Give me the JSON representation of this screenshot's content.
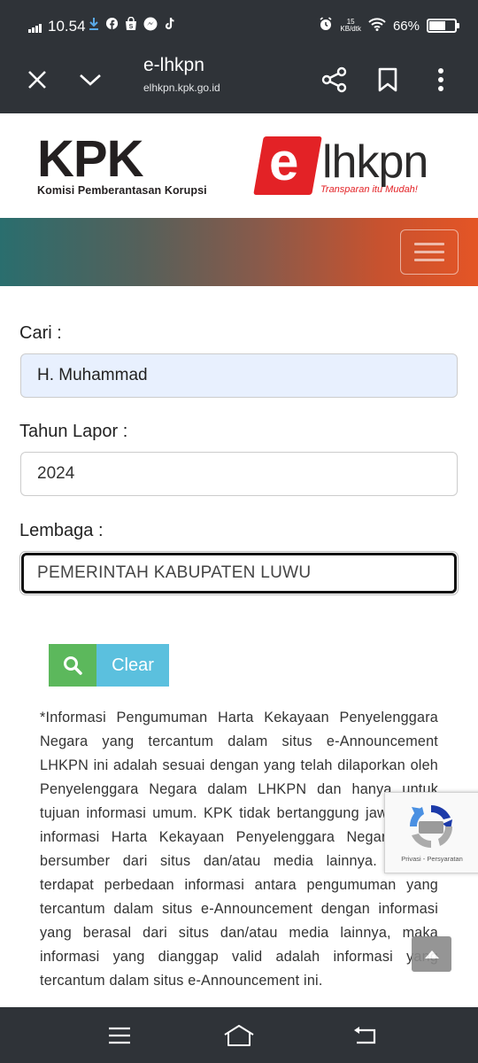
{
  "status_bar": {
    "time": "10.54",
    "kb_value": "15",
    "kb_unit": "KB/dtk",
    "battery": "66%",
    "battery_level": 0.66,
    "icons": [
      "signal-icon",
      "download-icon",
      "facebook-icon",
      "shop-icon",
      "messenger-icon",
      "tiktok-icon",
      "alarm-icon",
      "wifi-icon",
      "battery-icon"
    ]
  },
  "browser": {
    "title": "e-lhkpn",
    "url": "elhkpn.kpk.go.id"
  },
  "header": {
    "kpk_logo_text": "KPK",
    "kpk_subtitle": "Komisi Pemberantasan Korupsi",
    "elhkpn_e": "e",
    "elhkpn_rest": "lhkpn",
    "elhkpn_tagline": "Transparan itu Mudah!"
  },
  "form": {
    "cari_label": "Cari :",
    "cari_value": "H. Muhammad",
    "tahun_label": "Tahun Lapor :",
    "tahun_value": "2024",
    "lembaga_label": "Lembaga :",
    "lembaga_value": "PEMERINTAH KABUPATEN LUWU",
    "clear_label": "Clear"
  },
  "disclaimer": "*Informasi Pengumuman Harta Kekayaan Penyelenggara Negara yang tercantum dalam situs e-Announcement LHKPN ini adalah sesuai dengan yang telah dilaporkan oleh Penyelenggara Negara dalam LHKPN dan hanya untuk tujuan informasi umum. KPK tidak bertanggung jawab atas informasi Harta Kekayaan Penyelenggara Negara yang bersumber dari situs dan/atau media lainnya. Apabila terdapat perbedaan informasi antara pengumuman yang tercantum dalam situs e-Announcement dengan informasi yang berasal dari situs dan/atau media lainnya, maka informasi yang dianggap valid adalah informasi yang tercantum dalam situs e-Announcement ini.",
  "recaptcha": {
    "links": "Privasi - Persyaratan"
  },
  "colors": {
    "bar": "#2f3338",
    "search_button": "#5cb85c",
    "clear_button": "#5bc0de",
    "brand_red": "#e32226"
  }
}
